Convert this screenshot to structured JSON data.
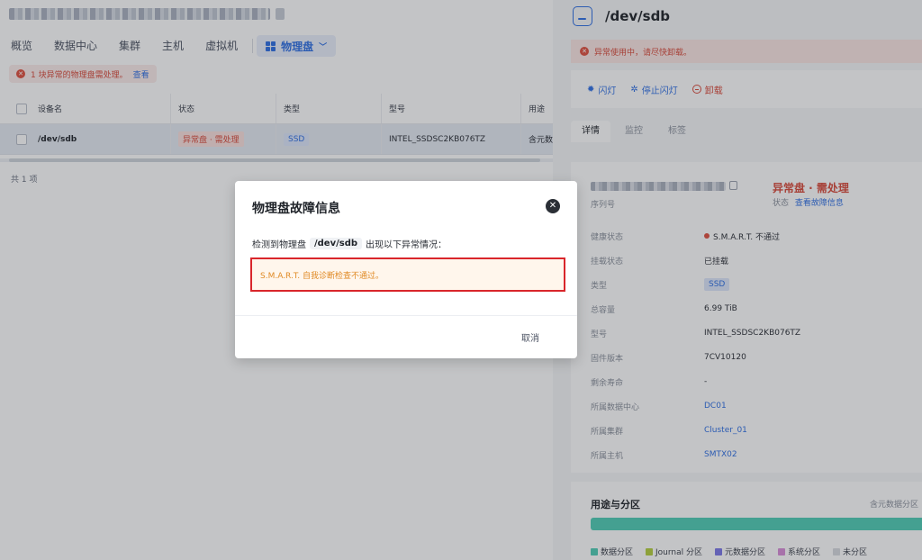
{
  "left": {
    "nav": {
      "items": [
        "概览",
        "数据中心",
        "集群",
        "主机",
        "虚拟机"
      ],
      "active": "物理盘"
    },
    "alert": {
      "text": "1 块异常的物理盘需处理。",
      "link": "查看"
    },
    "table": {
      "headers": [
        "设备名",
        "状态",
        "类型",
        "型号",
        "用途"
      ],
      "row": {
        "name": "/dev/sdb",
        "status": "异常盘 · 需处理",
        "type": "SSD",
        "model": "INTEL_SSDSC2KB076TZ",
        "usage": "含元数"
      }
    },
    "count": "共 1 项"
  },
  "right": {
    "title": "/dev/sdb",
    "alert": "异常使用中，请尽快卸载。",
    "actions": {
      "blink": "闪灯",
      "stop_blink": "停止闪灯",
      "unmount": "卸载"
    },
    "tabs": [
      "详情",
      "监控",
      "标签"
    ],
    "serial_label": "序列号",
    "status_big": "异常盘 · 需处理",
    "status_label": "状态",
    "status_link": "查看故障信息",
    "details": [
      {
        "k": "健康状态",
        "v": "S.M.A.R.T. 不通过"
      },
      {
        "k": "挂载状态",
        "v": "已挂载"
      },
      {
        "k": "类型",
        "v": "SSD"
      },
      {
        "k": "总容量",
        "v": "6.99 TiB"
      },
      {
        "k": "型号",
        "v": "INTEL_SSDSC2KB076TZ"
      },
      {
        "k": "固件版本",
        "v": "7CV10120"
      },
      {
        "k": "剩余寿命",
        "v": "-"
      },
      {
        "k": "所属数据中心",
        "v": "DC01"
      },
      {
        "k": "所属集群",
        "v": "Cluster_01"
      },
      {
        "k": "所属主机",
        "v": "SMTX02"
      }
    ],
    "usage": {
      "title": "用途与分区",
      "right_text": "含元数据分区",
      "legend": [
        {
          "label": "数据分区",
          "color": "#4fcdb6"
        },
        {
          "label": "Journal 分区",
          "color": "#b5cf3d"
        },
        {
          "label": "元数据分区",
          "color": "#7c78e8"
        },
        {
          "label": "系统分区",
          "color": "#d98ed8"
        },
        {
          "label": "未分区",
          "color": "#d7dae0"
        }
      ]
    }
  },
  "modal": {
    "title": "物理盘故障信息",
    "desc_prefix": "检测到物理盘",
    "device": "/dev/sdb",
    "desc_suffix": "出现以下异常情况：",
    "warning": "S.M.A.R.T. 自我诊断检查不通过。",
    "cancel": "取消",
    "close_glyph": "✕"
  },
  "colors": {
    "accent": "#2f6fe4",
    "danger": "#d94a3b",
    "warning": "#e08a25"
  }
}
